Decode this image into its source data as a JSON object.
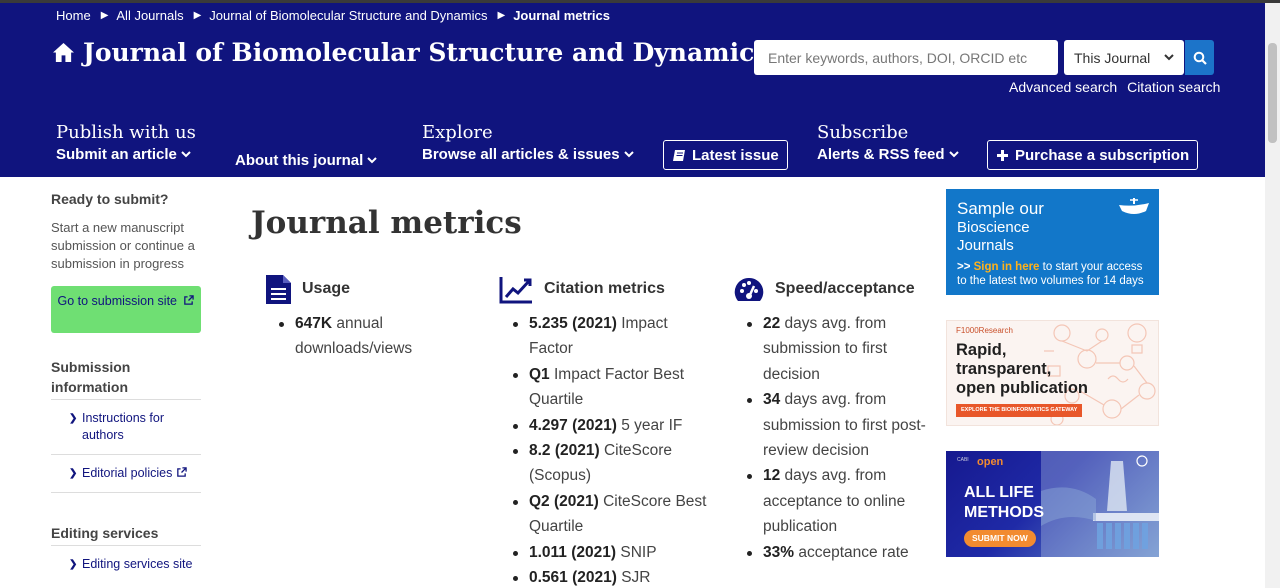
{
  "breadcrumb": [
    "Home",
    "All Journals",
    "Journal of Biomolecular Structure and Dynamics",
    "Journal metrics"
  ],
  "header": {
    "title": "Journal of Biomolecular Structure and Dynamics",
    "search_placeholder": "Enter keywords, authors, DOI, ORCID etc",
    "scope_value": "This Journal",
    "advanced_search": "Advanced search",
    "citation_search": "Citation search"
  },
  "nav": {
    "publish_heading": "Publish with us",
    "submit_article": "Submit an article",
    "about_journal": "About this journal",
    "explore_heading": "Explore",
    "browse_all": "Browse all articles & issues",
    "latest_issue": "Latest issue",
    "subscribe_heading": "Subscribe",
    "alerts": "Alerts & RSS feed",
    "purchase": "Purchase a subscription"
  },
  "sidebar": {
    "ready_heading": "Ready to submit?",
    "ready_text": "Start a new manuscript submission or continue a submission in progress",
    "submission_btn": "Go to submission site",
    "submission_info_heading": "Submission information",
    "instructions_link": "Instructions for authors",
    "editorial_link": "Editorial policies",
    "editing_heading": "Editing services",
    "editing_link": "Editing services site"
  },
  "page_title": "Journal metrics",
  "metrics": {
    "usage": {
      "heading": "Usage",
      "items": [
        {
          "bold": "647K",
          "text": " annual downloads/views"
        }
      ]
    },
    "citation": {
      "heading": "Citation metrics",
      "items": [
        {
          "bold": "5.235 (2021)",
          "text": " Impact Factor"
        },
        {
          "bold": "Q1",
          "text": " Impact Factor Best Quartile"
        },
        {
          "bold": "4.297 (2021)",
          "text": " 5 year IF"
        },
        {
          "bold": "8.2 (2021)",
          "text": " CiteScore (Scopus)"
        },
        {
          "bold": "Q2 (2021)",
          "text": " CiteScore Best Quartile"
        },
        {
          "bold": "1.011 (2021)",
          "text": " SNIP"
        },
        {
          "bold": "0.561 (2021)",
          "text": " SJR"
        }
      ]
    },
    "speed": {
      "heading": "Speed/acceptance",
      "items": [
        {
          "bold": "22",
          "text": " days avg. from submission to first decision"
        },
        {
          "bold": "34",
          "text": " days avg. from submission to first post-review decision"
        },
        {
          "bold": "12",
          "text": " days avg. from acceptance to online publication"
        },
        {
          "bold": "33%",
          "text": " acceptance rate"
        }
      ]
    }
  },
  "ads": {
    "ad1_title_1": "Sample our",
    "ad1_title_2": "Bioscience",
    "ad1_title_3": "Journals",
    "ad1_link": "Sign in here",
    "ad1_rest_1": " to start your access",
    "ad1_rest_2": "to the latest two volumes for 14 days",
    "ad2_brand": "F1000Research",
    "ad2_line1": "Rapid,",
    "ad2_line2": "transparent,",
    "ad2_line3": "open publication",
    "ad2_cta": "EXPLORE THE BIOINFORMATICS GATEWAY",
    "ad3_brand_small": "CABI",
    "ad3_brand": "open",
    "ad3_line1": "ALL LIFE",
    "ad3_line2": "METHODS",
    "ad3_cta": "SUBMIT NOW"
  }
}
